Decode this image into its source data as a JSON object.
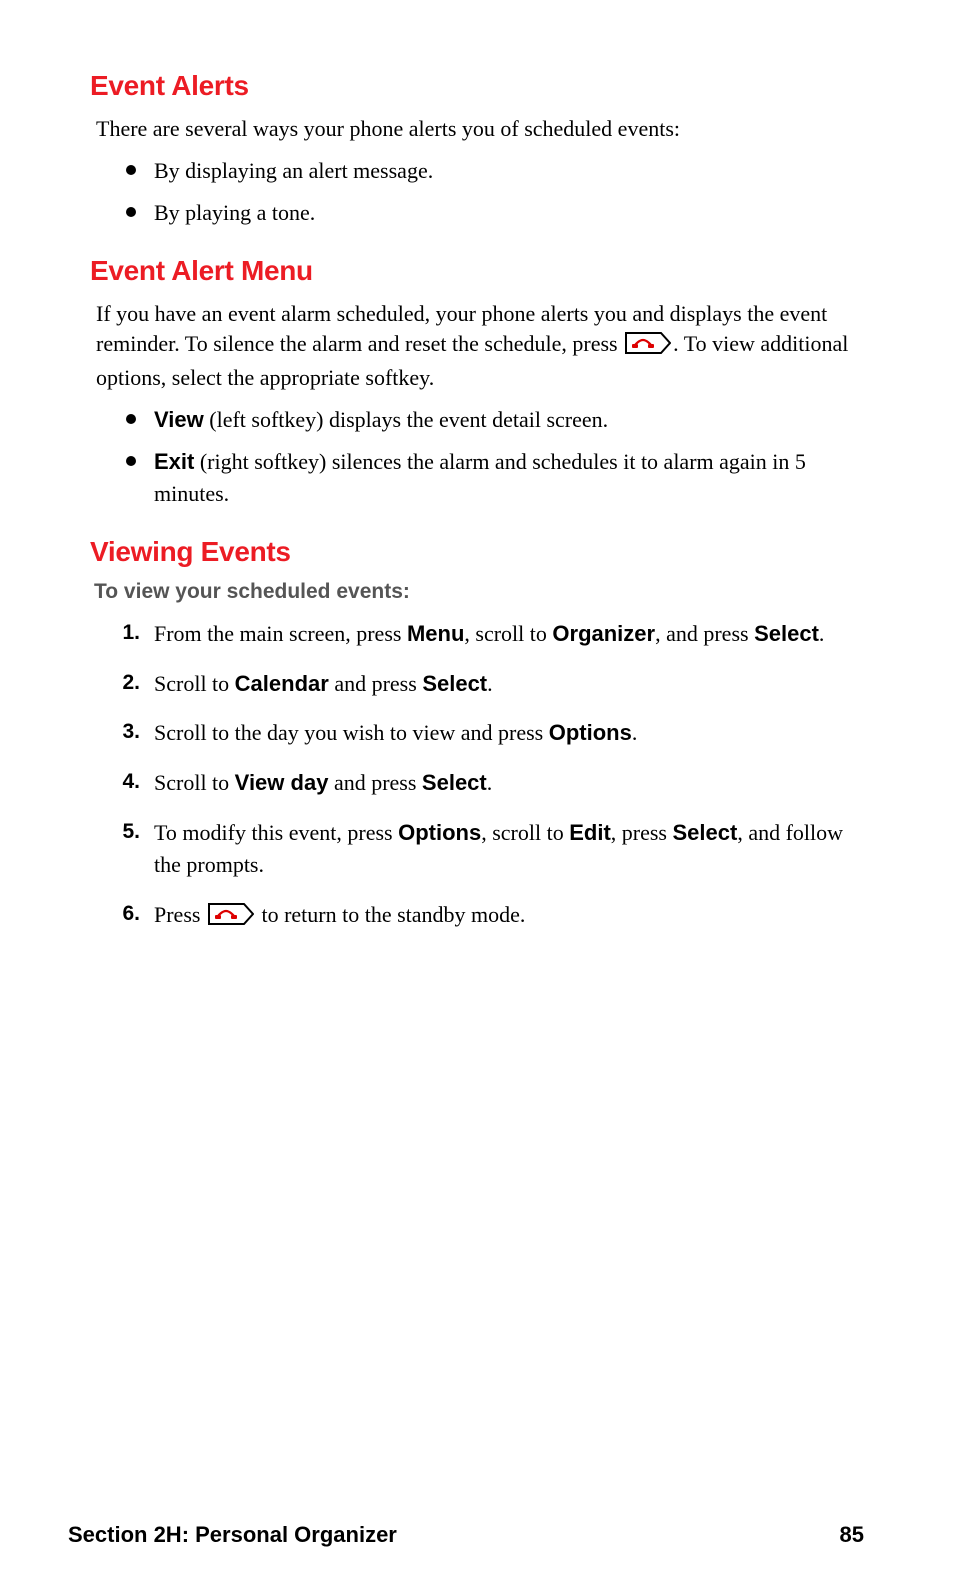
{
  "sections": [
    {
      "heading": "Event Alerts",
      "intro": "There are several ways your phone alerts you of scheduled events:",
      "bullets": [
        {
          "text": "By displaying an alert message."
        },
        {
          "text": "By playing a tone."
        }
      ]
    },
    {
      "heading": "Event Alert Menu",
      "intro_parts": {
        "p1": "If you have an event alarm scheduled, your phone alerts you and displays the event reminder. To silence the alarm and reset the schedule, press ",
        "p2": ". To view additional options, select the appropriate softkey."
      },
      "bullets": [
        {
          "bold": "View",
          "rest": " (left softkey) displays the event detail screen."
        },
        {
          "bold": "Exit",
          "rest": " (right softkey) silences the alarm and schedules it to alarm again in 5 minutes."
        }
      ]
    },
    {
      "heading": "Viewing Events",
      "sublabel": "To view your scheduled events:",
      "steps": [
        {
          "num": "1.",
          "segments": [
            {
              "t": "From the main screen, press "
            },
            {
              "t": "Menu",
              "b": true
            },
            {
              "t": ", scroll to "
            },
            {
              "t": "Organizer",
              "b": true
            },
            {
              "t": ", and press "
            },
            {
              "t": "Select",
              "b": true
            },
            {
              "t": "."
            }
          ]
        },
        {
          "num": "2.",
          "segments": [
            {
              "t": "Scroll to "
            },
            {
              "t": "Calendar",
              "b": true
            },
            {
              "t": " and press "
            },
            {
              "t": "Select",
              "b": true
            },
            {
              "t": "."
            }
          ]
        },
        {
          "num": "3.",
          "segments": [
            {
              "t": "Scroll to the day you wish to view and press "
            },
            {
              "t": "Options",
              "b": true
            },
            {
              "t": "."
            }
          ]
        },
        {
          "num": "4.",
          "segments": [
            {
              "t": "Scroll to "
            },
            {
              "t": "View day",
              "b": true
            },
            {
              "t": " and press "
            },
            {
              "t": "Select",
              "b": true
            },
            {
              "t": "."
            }
          ]
        },
        {
          "num": "5.",
          "segments": [
            {
              "t": "To modify this event, press "
            },
            {
              "t": "Options",
              "b": true
            },
            {
              "t": ", scroll to "
            },
            {
              "t": "Edit",
              "b": true
            },
            {
              "t": ", press "
            },
            {
              "t": "Select",
              "b": true
            },
            {
              "t": ", and follow the prompts."
            }
          ]
        },
        {
          "num": "6.",
          "segments": [
            {
              "t": "Press "
            },
            {
              "icon": "end-key-icon"
            },
            {
              "t": " to return to the standby mode."
            }
          ]
        }
      ]
    }
  ],
  "icons": {
    "end-key-icon": "end-key-icon"
  },
  "footer": {
    "left": "Section 2H: Personal Organizer",
    "right": "85"
  }
}
